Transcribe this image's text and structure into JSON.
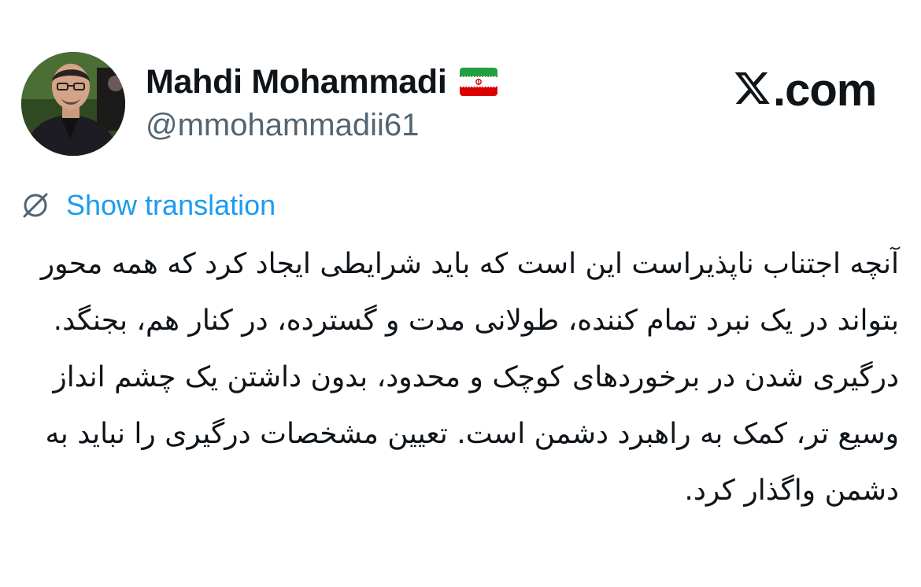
{
  "author": {
    "display_name": "Mahdi Mohammadi",
    "flag_icon": "iran-flag-icon",
    "handle": "@mmohammadii61",
    "avatar_icon": "profile-photo"
  },
  "brand": {
    "logo_icon": "x-logo-icon",
    "text": ".com"
  },
  "translation": {
    "icon": "globe-translate-icon",
    "label": "Show translation"
  },
  "tweet": {
    "text": "آنچه اجتناب ناپذیراست این است که باید شرایطی ایجاد کرد که همه محور بتواند در یک نبرد تمام کننده، طولانی مدت و گسترده، در کنار هم، بجنگد. درگیری شدن در برخوردهای کوچک و محدود، بدون داشتن یک چشم انداز وسیع تر، کمک به راهبرد دشمن است. تعیین مشخصات درگیری را نباید به دشمن واگذار کرد."
  },
  "colors": {
    "text_primary": "#0f1419",
    "text_secondary": "#536471",
    "link": "#1d9bf0",
    "background": "#ffffff"
  }
}
